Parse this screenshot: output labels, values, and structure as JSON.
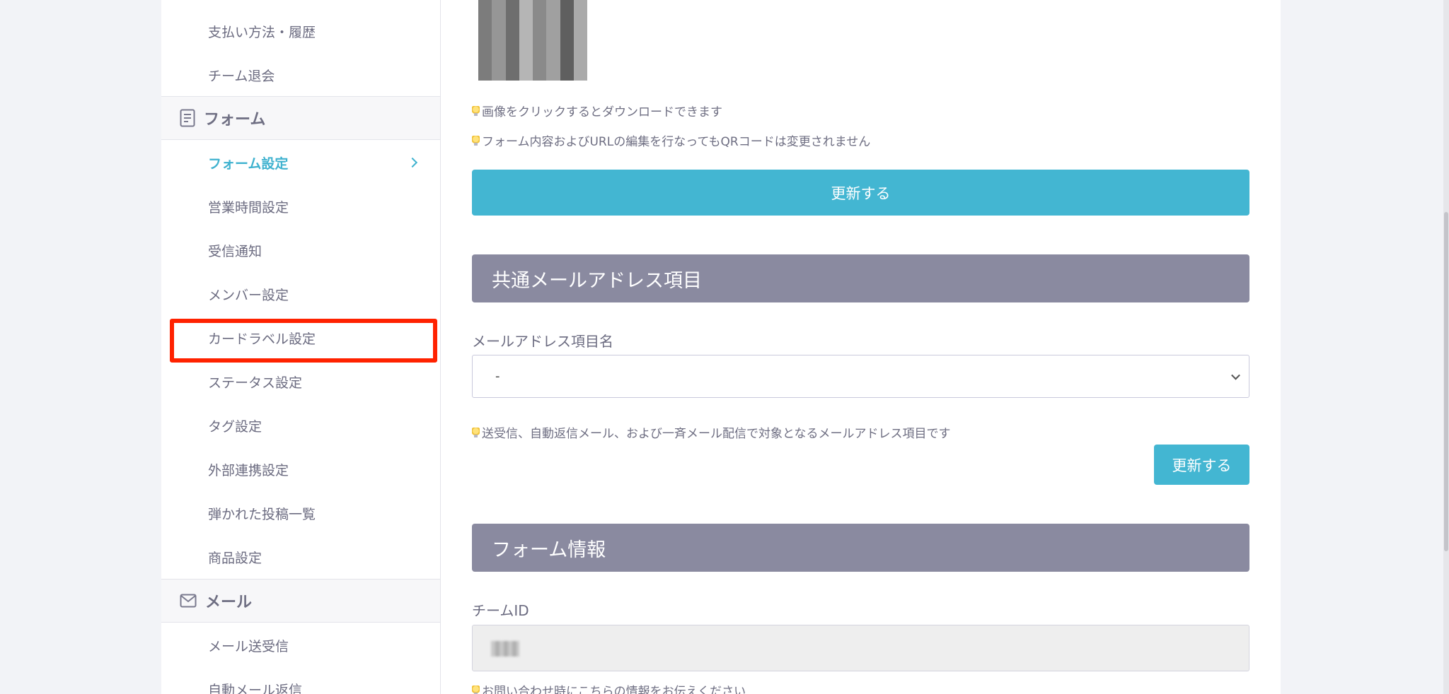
{
  "sidebar": {
    "team_items": [
      {
        "label": "支払い方法・履歴"
      },
      {
        "label": "チーム退会"
      }
    ],
    "form_section": {
      "title": "フォーム",
      "icon": "document-icon"
    },
    "form_items": [
      {
        "label": "フォーム設定",
        "active": true
      },
      {
        "label": "営業時間設定"
      },
      {
        "label": "受信通知"
      },
      {
        "label": "メンバー設定"
      },
      {
        "label": "カードラベル設定",
        "highlighted": true
      },
      {
        "label": "ステータス設定"
      },
      {
        "label": "タグ設定"
      },
      {
        "label": "外部連携設定"
      },
      {
        "label": "弾かれた投稿一覧"
      },
      {
        "label": "商品設定"
      }
    ],
    "mail_section": {
      "title": "メール",
      "icon": "envelope-icon"
    },
    "mail_items": [
      {
        "label": "メール送受信"
      },
      {
        "label": "自動メール返信"
      }
    ]
  },
  "main": {
    "qr_notes": {
      "download": "画像をクリックするとダウンロードできます",
      "unchanged": "フォーム内容およびURLの編集を行なってもQRコードは変更されません"
    },
    "update_button_label": "更新する",
    "mail_section": {
      "title": "共通メールアドレス項目",
      "field_label": "メールアドレス項目名",
      "selected_value": "-",
      "note": "送受信、自動返信メール、および一斉メール配信で対象となるメールアドレス項目です",
      "update_button_label": "更新する"
    },
    "form_info": {
      "title": "フォーム情報",
      "team_id_label": "チームID",
      "note": "お問い合わせ時にこちらの情報をお伝えください"
    }
  },
  "colors": {
    "accent": "#43b6d2",
    "section_bar": "#8a8aa0",
    "highlight": "#ff2200"
  }
}
